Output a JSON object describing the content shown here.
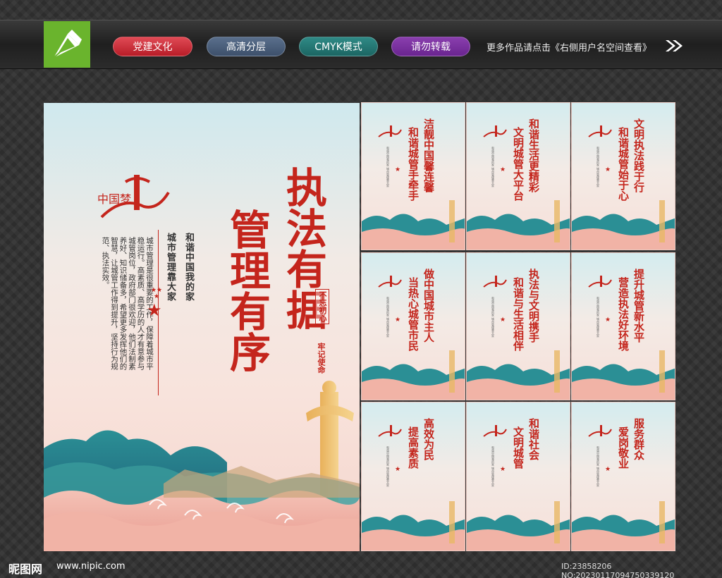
{
  "toolbar": {
    "pills": [
      "党建文化",
      "高清分层",
      "CMYK模式",
      "请勿转载"
    ],
    "more_text": "更多作品请点击《右侧用户名空间查看》",
    "arrows": "»",
    "colors": {
      "red": "#c4251c",
      "pill1": "#d4313c",
      "pill2": "#4a5d79",
      "pill3": "#24746f",
      "pill4": "#7a2fa0",
      "logo": "#6ab42d"
    }
  },
  "main_poster": {
    "title_line1": "执法有据",
    "title_line2": "管理有序",
    "subtitle_line1": "和谐中国我的家",
    "subtitle_line2": "城市管理靠大家",
    "body": "城市管理是很重要的工作，保障着城市平稳运行。高素质、高学历的人才有意参与城管岗位，政府部门很欢迎，他们法制素养好、知识储备多，希望更多发挥他们的智慧，让城管工作得到提升，坚持行为规范、执法实效。",
    "seal_1": "不忘初心",
    "seal_2": "牢记使命",
    "logo_text": "中国梦"
  },
  "small_posters": [
    {
      "line1": "洁靓中国馨连馨",
      "line2": "和谐城管手牵手"
    },
    {
      "line1": "和谐生活更精彩",
      "line2": "文明城管大平台"
    },
    {
      "line1": "文明执法践于行",
      "line2": "和谐城管始于心"
    },
    {
      "line1": "做中国城市主人",
      "line2": "当热心城管市民"
    },
    {
      "line1": "执法与文明携手",
      "line2": "和谐与生活相伴"
    },
    {
      "line1": "提升城管新水平",
      "line2": "营造执法好环境"
    },
    {
      "line1": "高效为民",
      "line2": "提高素质"
    },
    {
      "line1": "和谐社会",
      "line2": "文明城管"
    },
    {
      "line1": "服务群众",
      "line2": "爱岗敬业"
    }
  ],
  "small_sub": "和谐中国我的家 城市管理靠大家",
  "footer": {
    "site_logo": "昵图网",
    "url": "www.nipic.com",
    "id_text": "ID:23858206 NO:20230117094750339120"
  }
}
